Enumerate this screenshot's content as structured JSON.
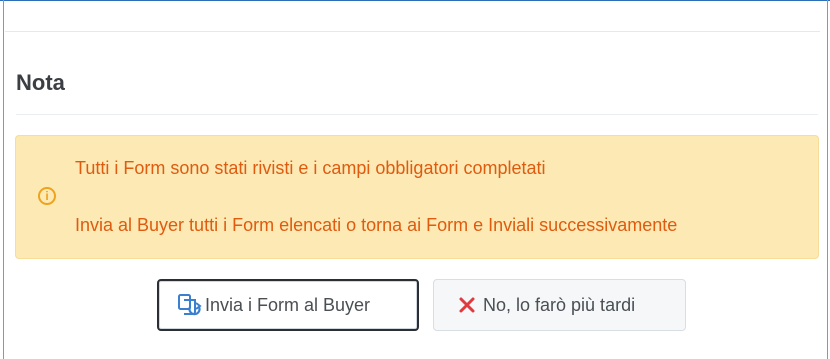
{
  "note": {
    "title": "Nota"
  },
  "alert": {
    "icon": "info-icon",
    "icon_glyph": "i",
    "line1": "Tutti i Form sono stati rivisti e i campi obbligatori completati",
    "line2": "Invia al Buyer tutti i Form elencati o torna ai Form e Inviali successivamente",
    "background_color": "#fde9b4",
    "text_color": "#de5b10",
    "icon_color": "#eea31e"
  },
  "actions": {
    "send_button": {
      "label": "Invia i Form al Buyer",
      "icon": "send-forms-icon",
      "icon_color": "#3b7fd0"
    },
    "later_button": {
      "label": "No, lo farò più tardi",
      "icon": "close-icon",
      "icon_color": "#e0393e"
    }
  }
}
